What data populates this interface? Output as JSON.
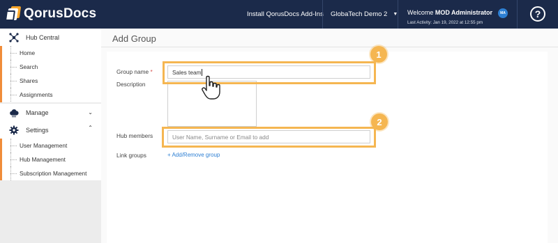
{
  "app": {
    "logo_text": "QorusDocs"
  },
  "topbar": {
    "install_link": "Install QorusDocs Add-Ins",
    "tenant": "GlobaTech Demo 2",
    "welcome_prefix": "Welcome",
    "user_name": "MOD Administrator",
    "last_activity": "Last Activity: Jan 19, 2022 at 12:55 pm",
    "avatar_initials": "MA",
    "help_glyph": "?"
  },
  "sidebar": {
    "hub_central": {
      "label": "Hub Central",
      "icon": "hub-network-icon",
      "items": [
        {
          "label": "Home"
        },
        {
          "label": "Search"
        },
        {
          "label": "Shares"
        },
        {
          "label": "Assignments"
        }
      ]
    },
    "manage": {
      "label": "Manage",
      "icon": "cloud-icon",
      "chevron": "chevron-down-icon"
    },
    "settings": {
      "label": "Settings",
      "icon": "gear-icon",
      "chevron": "chevron-up-icon",
      "items": [
        {
          "label": "User Management"
        },
        {
          "label": "Hub Management"
        },
        {
          "label": "Subscription Management"
        }
      ]
    }
  },
  "main": {
    "title": "Add Group",
    "form": {
      "group_name_label": "Group name",
      "required_mark": "*",
      "group_name_value": "Sales team",
      "description_label": "Description",
      "description_value": "",
      "hub_members_label": "Hub members",
      "hub_members_placeholder": "User Name, Surname or Email to add",
      "link_groups_label": "Link groups",
      "link_groups_action": "+ Add/Remove group"
    },
    "callouts": [
      {
        "number": "1"
      },
      {
        "number": "2"
      }
    ]
  },
  "colors": {
    "topbar": "#1b2a4a",
    "accent_orange": "#f08c3a",
    "callout": "#f5b651",
    "link": "#2d7fd3"
  }
}
